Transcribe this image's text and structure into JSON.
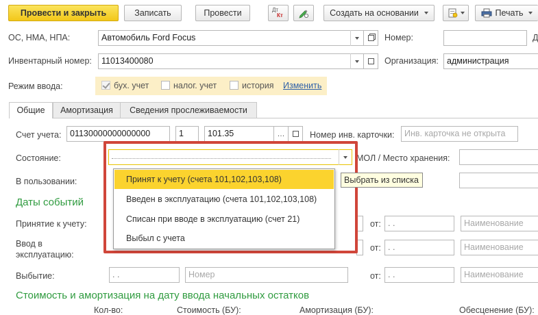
{
  "toolbar": {
    "post_close": "Провести и закрыть",
    "save": "Записать",
    "post": "Провести",
    "dtkt_top": "Дт",
    "dtkt_bottom": "Кт",
    "create_based": "Создать на основании",
    "print": "Печать"
  },
  "header": {
    "asset_label": "ОС, НМА, НПА:",
    "asset_value": "Автомобиль Ford Focus",
    "number_label": "Номер:",
    "number_value": "",
    "inv_label": "Инвентарный номер:",
    "inv_value": "11013400080",
    "org_label": "Организация:",
    "org_value": "администрация",
    "mode_label": "Режим ввода:",
    "mode_opt1": "бух. учет",
    "mode_opt2": "налог. учет",
    "mode_opt3": "история",
    "mode_change": "Изменить",
    "cut_letter": "Д"
  },
  "tabs": [
    "Общие",
    "Амортизация",
    "Сведения прослеживаемости"
  ],
  "general": {
    "account_label": "Счет учета:",
    "account_value": "01130000000000000",
    "account_kfo": "1",
    "account_sub": "101.35",
    "inv_card_label": "Номер инв. карточки:",
    "inv_card_placeholder": "Инв. карточка не открыта",
    "state_label": "Состояние:",
    "state_value": "",
    "mol_label": "МОЛ / Место хранения:",
    "in_use_label": "В пользовании:",
    "tooltip": "Выбрать из списка"
  },
  "dropdown": {
    "items": [
      "Принят к учету (счета 101,102,103,108)",
      "Введен в эксплуатацию (счета 101,102,103,108)",
      "Списан при вводе в эксплуатацию (счет 21)",
      "Выбыл с учета"
    ],
    "highlight_color": "#fbd32e",
    "frame_color": "#d0463a"
  },
  "events": {
    "section_title": "Даты событий",
    "accepted_label": "Принятие к учету:",
    "commission_label": "Ввод в эксплуатацию:",
    "disposal_label": "Выбытие:",
    "from_label": "от:",
    "date_empty": " .  .",
    "name_placeholder": "Наименование",
    "number_placeholder": "Номер"
  },
  "cost": {
    "section_title": "Стоимость и амортизация на дату ввода начальных остатков",
    "col1": "Кол-во:",
    "col2": "Стоимость (БУ):",
    "col3": "Амортизация (БУ):",
    "col4": "Обесценение (БУ):"
  }
}
